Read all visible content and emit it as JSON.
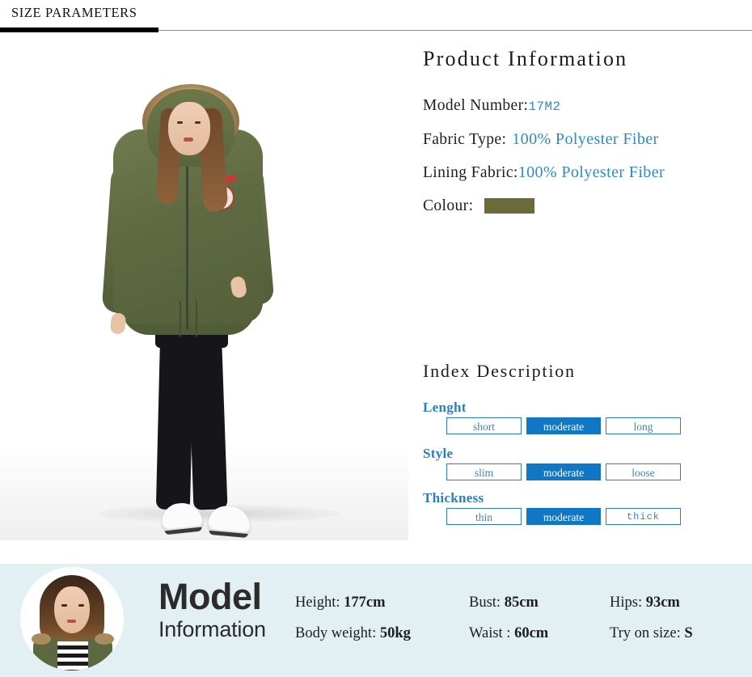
{
  "header": {
    "title": "SIZE PARAMETERS"
  },
  "product_photo": {
    "alt": "model wearing olive green fur-hooded parka with black leggings and white sneakers"
  },
  "product_information": {
    "title": "Product Information",
    "specs": [
      {
        "label": "Model Number:",
        "value": "17M2"
      },
      {
        "label": "Fabric Type:",
        "value": "100% Polyester Fiber"
      },
      {
        "label": "Lining Fabric:",
        "value": "100% Polyester Fiber"
      },
      {
        "label": "Colour:",
        "value": "",
        "swatch_color": "#6b6b3a"
      }
    ]
  },
  "index_description": {
    "title": "Index Description",
    "groups": [
      {
        "label": "Lenght",
        "options": [
          {
            "text": "short",
            "selected": false
          },
          {
            "text": "moderate",
            "selected": true
          },
          {
            "text": "long",
            "selected": false
          }
        ]
      },
      {
        "label": "Style",
        "options": [
          {
            "text": "slim",
            "selected": false
          },
          {
            "text": "moderate",
            "selected": true
          },
          {
            "text": "loose",
            "selected": false
          }
        ]
      },
      {
        "label": "Thickness",
        "options": [
          {
            "text": "thin",
            "selected": false
          },
          {
            "text": "moderate",
            "selected": true
          },
          {
            "text": "thick",
            "selected": false
          }
        ]
      }
    ]
  },
  "model_information": {
    "heading": "Model",
    "subheading": "Information",
    "avatar_alt": "model portrait headshot",
    "fields": [
      {
        "label": "Height:",
        "value": "177cm"
      },
      {
        "label": "Body weight:",
        "value": "50kg"
      },
      {
        "label": "Bust:",
        "value": "85cm"
      },
      {
        "label": "Waist :",
        "value": "60cm"
      },
      {
        "label": "Hips:",
        "value": "93cm"
      },
      {
        "label": "Try on size:",
        "value": "S"
      }
    ]
  },
  "colors": {
    "accent_blue": "#1177c4",
    "label_blue": "#2a7fc0",
    "value_blue": "#2a8ccd",
    "swatch_olive": "#6b6b3a",
    "model_bar_bg": "#e3f0f3",
    "header_bar": "#000000"
  }
}
